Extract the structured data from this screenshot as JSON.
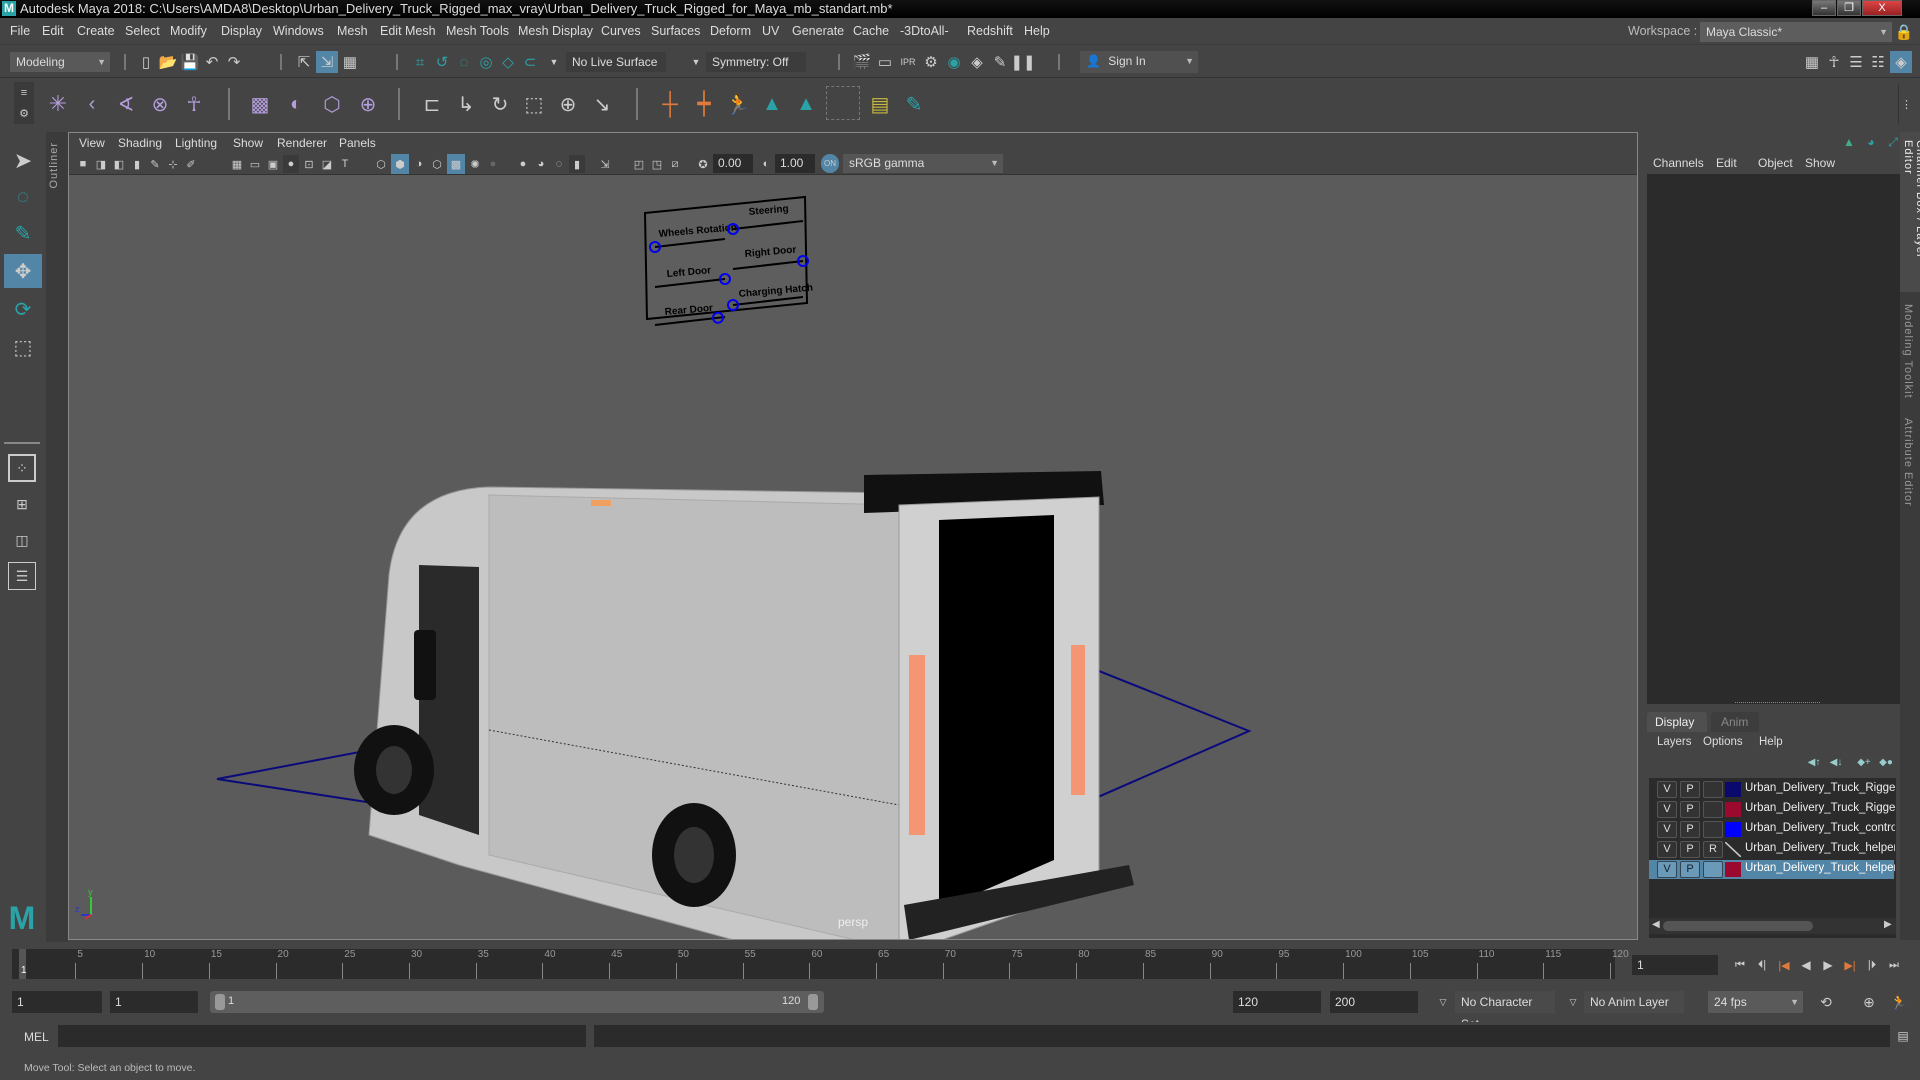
{
  "window": {
    "title": "Autodesk Maya 2018: C:\\Users\\AMDA8\\Desktop\\Urban_Delivery_Truck_Rigged_max_vray\\Urban_Delivery_Truck_Rigged_for_Maya_mb_standart.mb*",
    "logo": "M",
    "minimize": "–",
    "restore": "❐",
    "close": "X"
  },
  "menubar": {
    "items": [
      "File",
      "Edit",
      "Create",
      "Select",
      "Modify",
      "Display",
      "Windows",
      "Mesh",
      "Edit Mesh",
      "Mesh Tools",
      "Mesh Display",
      "Curves",
      "Surfaces",
      "Deform",
      "UV",
      "Generate",
      "Cache",
      "-3DtoAll-",
      "Redshift",
      "Help"
    ],
    "workspace_label": "Workspace :",
    "workspace_value": "Maya Classic*"
  },
  "statusline": {
    "menuset": "Modeling",
    "live_surface": "No Live Surface",
    "symmetry": "Symmetry: Off",
    "sign_in": "Sign In"
  },
  "viewport": {
    "menus": [
      "View",
      "Shading",
      "Lighting",
      "Show",
      "Renderer",
      "Panels"
    ],
    "exposure": "0.00",
    "gamma": "1.00",
    "color_space": "sRGB gamma",
    "camera_label": "persp",
    "control_board": {
      "labels": [
        "Wheels Rotation",
        "Steering",
        "Left Door",
        "Right Door",
        "Rear Door",
        "Charging Hatch"
      ],
      "slider_values": [
        0.0,
        0.0,
        1.0,
        1.0,
        0.9,
        0.0
      ]
    },
    "axis": {
      "x": "x",
      "y": "y",
      "z": "z"
    }
  },
  "channelbox": {
    "menus": [
      "Channels",
      "Edit",
      "Object",
      "Show"
    ],
    "side_tabs": [
      "Channel Box / Layer Editor",
      "Modeling Toolkit",
      "Attribute Editor"
    ]
  },
  "layer_editor": {
    "tabs": [
      "Display",
      "Anim"
    ],
    "active_tab": "Display",
    "menus": [
      "Layers",
      "Options",
      "Help"
    ],
    "layers": [
      {
        "v": "V",
        "p": "P",
        "r": "",
        "color": "#0a0a6e",
        "name": "Urban_Delivery_Truck_Rigged_",
        "selected": false
      },
      {
        "v": "V",
        "p": "P",
        "r": "",
        "color": "#9b0a2e",
        "name": "Urban_Delivery_Truck_Rigged_",
        "selected": false
      },
      {
        "v": "V",
        "p": "P",
        "r": "",
        "color": "#0000ff",
        "name": "Urban_Delivery_Truck_controll",
        "selected": false
      },
      {
        "v": "V",
        "p": "P",
        "r": "R",
        "color": "none",
        "name": "Urban_Delivery_Truck_helpers_",
        "selected": false
      },
      {
        "v": "V",
        "p": "P",
        "r": "",
        "color": "#9b0a2e",
        "name": "Urban_Delivery_Truck_helpers",
        "selected": true
      }
    ]
  },
  "timeline": {
    "ticks": [
      "5",
      "10",
      "15",
      "20",
      "25",
      "30",
      "35",
      "40",
      "45",
      "50",
      "55",
      "60",
      "65",
      "70",
      "75",
      "80",
      "85",
      "90",
      "95",
      "100",
      "105",
      "110",
      "115",
      "120"
    ],
    "current_frame_marker": "1",
    "current_frame": "1"
  },
  "range": {
    "start": "1",
    "playback_start": "1",
    "slider_start": "1",
    "slider_end": "120",
    "playback_end": "120",
    "end": "200",
    "character_set": "No Character Set",
    "anim_layer": "No Anim Layer",
    "fps": "24 fps"
  },
  "command": {
    "language": "MEL",
    "input": "",
    "result": ""
  },
  "helpline": {
    "text": "Move Tool: Select an object to move."
  },
  "colors": {
    "accent": "#5285a6",
    "teal": "#2aa3a8",
    "orange": "#e07a3c",
    "bg": "#444444",
    "viewport_bg": "#5b5b5b"
  }
}
